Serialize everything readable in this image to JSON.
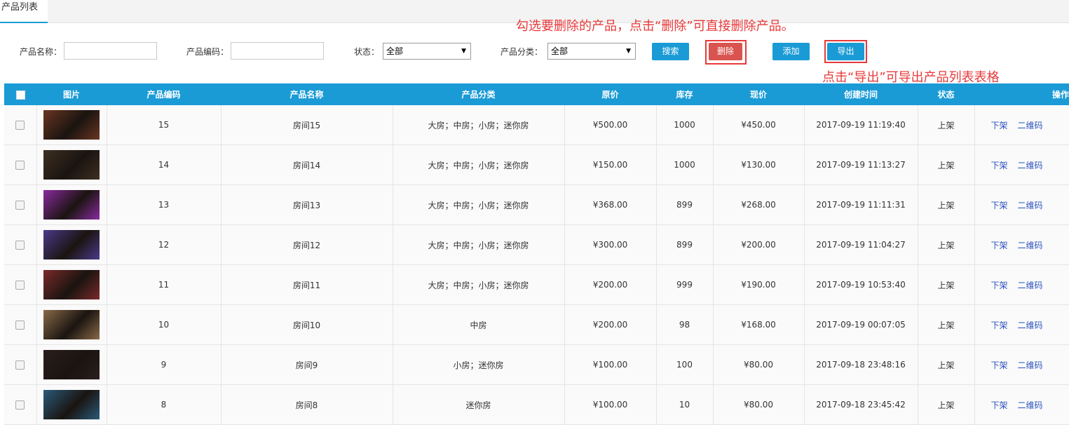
{
  "tab": {
    "label": "产品列表"
  },
  "filters": {
    "name_label": "产品名称：",
    "code_label": "产品编码：",
    "status_label": "状态：",
    "status_value": "全部",
    "category_label": "产品分类：",
    "category_value": "全部",
    "search_label": "搜索",
    "delete_label": "删除",
    "add_label": "添加",
    "export_label": "导出"
  },
  "notes": {
    "delete_note": "勾选要删除的产品，点击“删除”可直接删除产品。",
    "export_note": "点击“导出”可导出产品列表表格"
  },
  "table": {
    "headers": [
      "",
      "图片",
      "产品编码",
      "产品名称",
      "产品分类",
      "原价",
      "库存",
      "现价",
      "创建时间",
      "状态",
      "操作"
    ],
    "rows": [
      {
        "code": "15",
        "name": "房间15",
        "category": "大房；中房；小房；迷你房",
        "price": "¥500.00",
        "stock": "1000",
        "now": "¥450.00",
        "created": "2017-09-19 11:19:40",
        "status": "上架",
        "op1": "下架",
        "op2": "二维码",
        "thumb": "#6a3522"
      },
      {
        "code": "14",
        "name": "房间14",
        "category": "大房；中房；小房；迷你房",
        "price": "¥150.00",
        "stock": "1000",
        "now": "¥130.00",
        "created": "2017-09-19 11:13:27",
        "status": "上架",
        "op1": "下架",
        "op2": "二维码",
        "thumb": "#3e2f22"
      },
      {
        "code": "13",
        "name": "房间13",
        "category": "大房；中房；小房；迷你房",
        "price": "¥368.00",
        "stock": "899",
        "now": "¥268.00",
        "created": "2017-09-19 11:11:31",
        "status": "上架",
        "op1": "下架",
        "op2": "二维码",
        "thumb": "#8a2aa0"
      },
      {
        "code": "12",
        "name": "房间12",
        "category": "大房；中房；小房；迷你房",
        "price": "¥300.00",
        "stock": "899",
        "now": "¥200.00",
        "created": "2017-09-19 11:04:27",
        "status": "上架",
        "op1": "下架",
        "op2": "二维码",
        "thumb": "#4a3a8a"
      },
      {
        "code": "11",
        "name": "房间11",
        "category": "大房；中房；小房；迷你房",
        "price": "¥200.00",
        "stock": "999",
        "now": "¥190.00",
        "created": "2017-09-19 10:53:40",
        "status": "上架",
        "op1": "下架",
        "op2": "二维码",
        "thumb": "#7a2a2a"
      },
      {
        "code": "10",
        "name": "房间10",
        "category": "中房",
        "price": "¥200.00",
        "stock": "98",
        "now": "¥168.00",
        "created": "2017-09-19 00:07:05",
        "status": "上架",
        "op1": "下架",
        "op2": "二维码",
        "thumb": "#8a6a48"
      },
      {
        "code": "9",
        "name": "房间9",
        "category": "小房；迷你房",
        "price": "¥100.00",
        "stock": "100",
        "now": "¥80.00",
        "created": "2017-09-18 23:48:16",
        "status": "上架",
        "op1": "下架",
        "op2": "二维码",
        "thumb": "#2a1e1c"
      },
      {
        "code": "8",
        "name": "房间8",
        "category": "迷你房",
        "price": "¥100.00",
        "stock": "10",
        "now": "¥80.00",
        "created": "2017-09-18 23:45:42",
        "status": "上架",
        "op1": "下架",
        "op2": "二维码",
        "thumb": "#2a5a7a"
      }
    ]
  }
}
